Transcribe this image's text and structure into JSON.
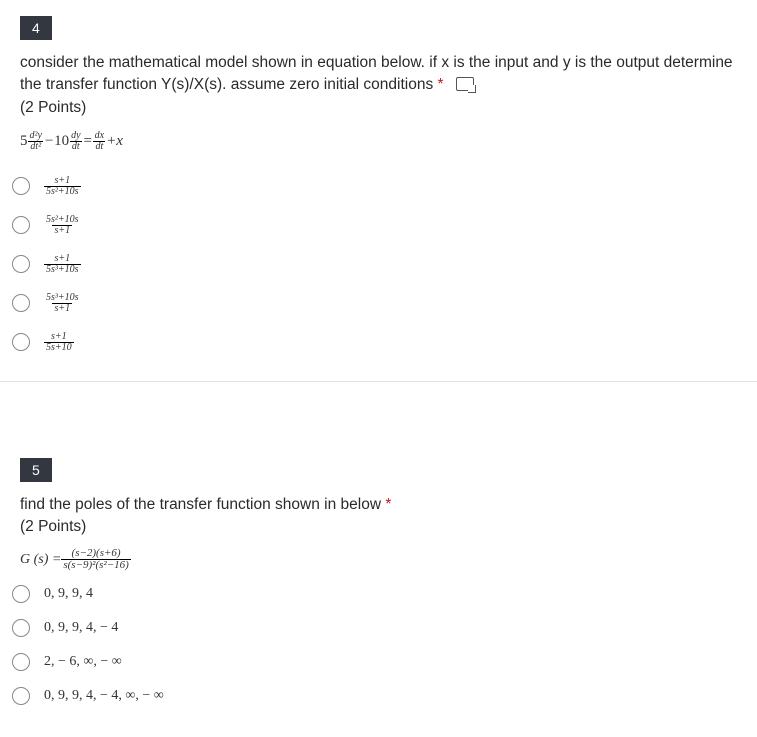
{
  "q4": {
    "number": "4",
    "text": "consider the mathematical model shown in equation below. if x is the input and y is the output determine the transfer function Y(s)/X(s). assume zero initial conditions",
    "points": "(2 Points)",
    "eq": {
      "c1": "5",
      "f1n": "d²y",
      "f1d": "dt²",
      "op1": " − ",
      "c2": "10",
      "f2n": "dy",
      "f2d": "dt",
      "op2": " = ",
      "f3n": "dx",
      "f3d": "dt",
      "op3": " + ",
      "tail": "x"
    },
    "opts": [
      {
        "num": "s+1",
        "den": "5s²+10s"
      },
      {
        "num": "5s²+10s",
        "den": "s+1"
      },
      {
        "num": "s+1",
        "den": "5s³+10s"
      },
      {
        "num": "5s³+10s",
        "den": "s+1"
      },
      {
        "num": "s+1",
        "den": "5s+10"
      }
    ]
  },
  "q5": {
    "number": "5",
    "text": "find the poles of the transfer function shown in below",
    "points": "(2 Points)",
    "gs": {
      "lhs": "G (s) = ",
      "num": "(s−2)(s+6)",
      "den": "s(s−9)²(s²−16)"
    },
    "opts": [
      "0, 9, 9, 4",
      "0, 9, 9, 4,  − 4",
      "2,  − 6, ∞,  − ∞",
      "0, 9, 9, 4,  − 4, ∞,  − ∞"
    ]
  }
}
